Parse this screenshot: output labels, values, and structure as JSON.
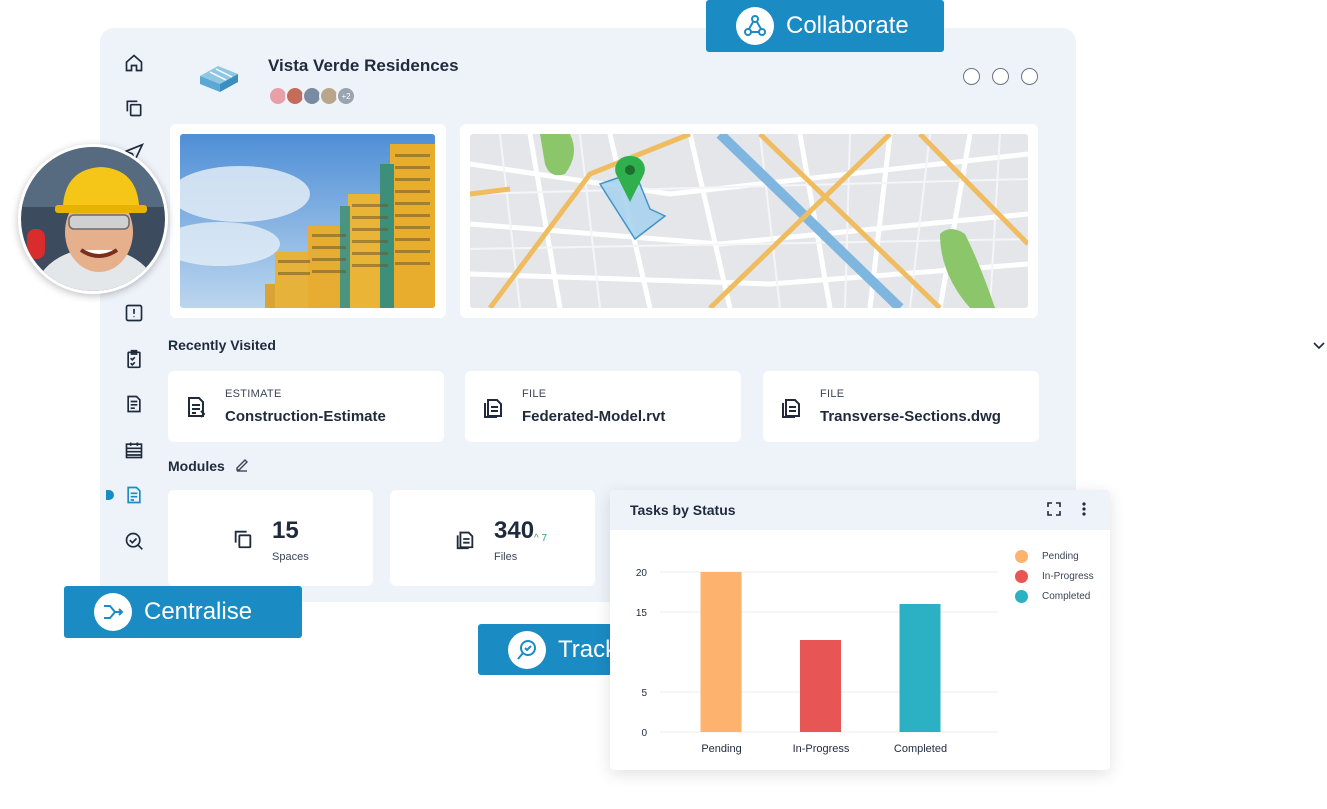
{
  "project": {
    "title": "Vista Verde Residences",
    "extra_members": "+2"
  },
  "recent": {
    "title": "Recently Visited",
    "items": [
      {
        "type": "ESTIMATE",
        "name": "Construction-Estimate",
        "icon": "estimate-icon"
      },
      {
        "type": "FILE",
        "name": "Federated-Model.rvt",
        "icon": "file-icon"
      },
      {
        "type": "FILE",
        "name": "Transverse-Sections.dwg",
        "icon": "file-icon"
      }
    ]
  },
  "modules": {
    "title": "Modules",
    "items": [
      {
        "value": "15",
        "label": "Spaces",
        "icon": "spaces-icon"
      },
      {
        "value": "340",
        "label": "Files",
        "icon": "files-icon",
        "trend": "7"
      }
    ]
  },
  "badges": {
    "collaborate": "Collaborate",
    "centralise": "Centralise",
    "track": "Track"
  },
  "chart_data": {
    "type": "bar",
    "title": "Tasks by Status",
    "categories": [
      "Pending",
      "In-Progress",
      "Completed"
    ],
    "values": [
      20,
      11.5,
      16
    ],
    "colors": [
      "#fdb26e",
      "#e85555",
      "#2bb0c4"
    ],
    "legend": [
      "Pending",
      "In-Progress",
      "Completed"
    ],
    "legend_position": "top-right",
    "y_ticks": [
      "0",
      "5",
      "15",
      "20"
    ],
    "ylim": [
      0,
      20
    ],
    "grid": true
  },
  "colors": {
    "accent": "#1b8bc4",
    "frame": "#eef3fa"
  }
}
